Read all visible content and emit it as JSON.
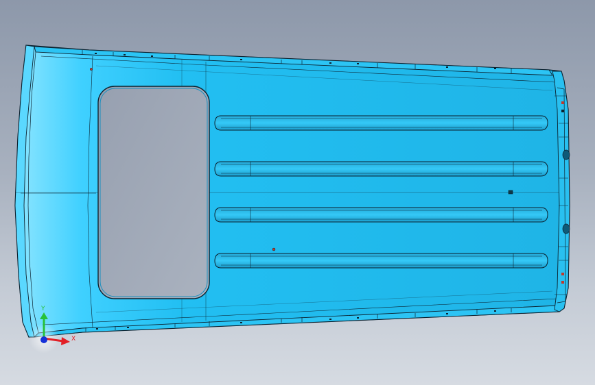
{
  "viewport": {
    "background_top": "#8d98aa",
    "background_bottom": "#d6dbe2"
  },
  "model": {
    "part": "roof-panel",
    "body_color": "#1fb8ec",
    "highlight_color": "#8fe6ff",
    "edge_color": "#0b2230",
    "window_opening_color": "#9aa3b2",
    "rib_count": 4
  },
  "triad": {
    "x_label": "X",
    "y_label": "Y",
    "x_color": "#e21f26",
    "y_color": "#27c13a",
    "z_color": "#1530d8"
  }
}
